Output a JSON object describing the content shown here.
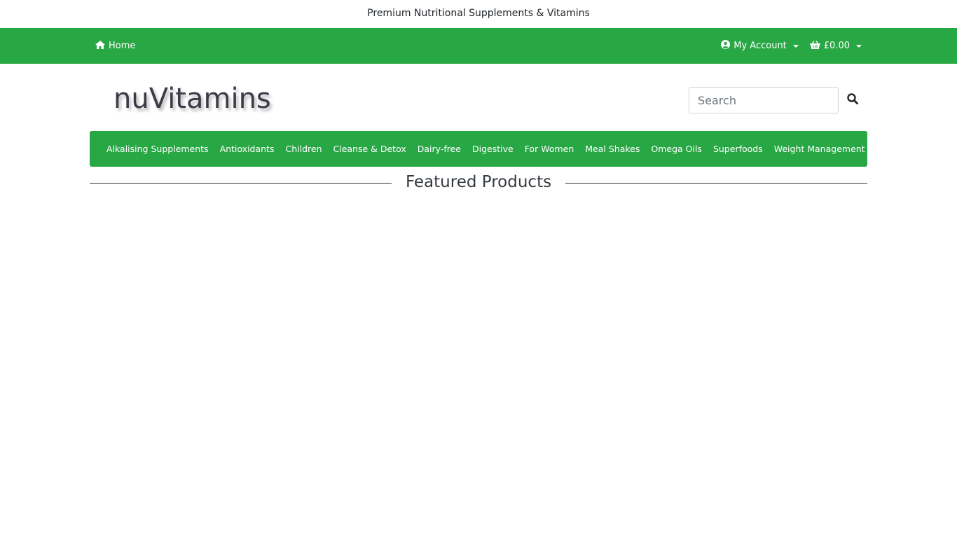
{
  "tagline": "Premium Nutritional Supplements & Vitamins",
  "topbar": {
    "home_label": "Home",
    "account_label": "My Account",
    "cart_total": "£0.00",
    "bg_color": "#28a745"
  },
  "header": {
    "logo_text": "nuVitamins",
    "search": {
      "placeholder": "Search",
      "value": ""
    }
  },
  "categories": [
    "Alkalising Supplements",
    "Antioxidants",
    "Children",
    "Cleanse & Detox",
    "Dairy-free",
    "Digestive",
    "For Women",
    "Meal Shakes",
    "Omega Oils",
    "Superfoods",
    "Weight Management"
  ],
  "featured": {
    "title": "Featured Products"
  },
  "icons": {
    "home": "home-icon",
    "account": "user-circle-icon",
    "cart": "basket-icon",
    "search": "search-icon"
  }
}
